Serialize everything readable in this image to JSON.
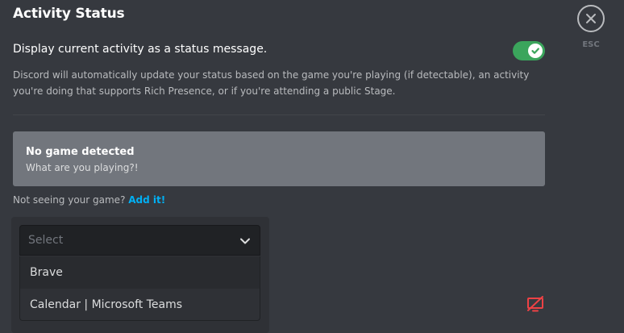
{
  "header": {
    "title": "Activity Status",
    "close_icon": "close-icon",
    "esc_label": "ESC"
  },
  "setting": {
    "label": "Display current activity as a status message.",
    "toggle_on": true,
    "description": "Discord will automatically update your status based on the game you're playing (if detectable), an activity you're doing that supports Rich Presence, or if you're attending a public Stage."
  },
  "game_detection": {
    "title": "No game detected",
    "subtitle": "What are you playing?!",
    "not_seeing_text": "Not seeing your game?",
    "add_link": "Add it!"
  },
  "game_select": {
    "placeholder": "Select",
    "options": [
      {
        "label": "Brave",
        "hovered": true
      },
      {
        "label": "Calendar | Microsoft Teams",
        "hovered": false
      }
    ]
  },
  "partial_text": "L",
  "overlay_icon": "overlay-disabled-icon",
  "colors": {
    "background": "#36393f",
    "toggle_green": "#3ba55c",
    "link_blue": "#00b0f4",
    "danger_red": "#ed4245",
    "card_gray": "#72767d"
  }
}
